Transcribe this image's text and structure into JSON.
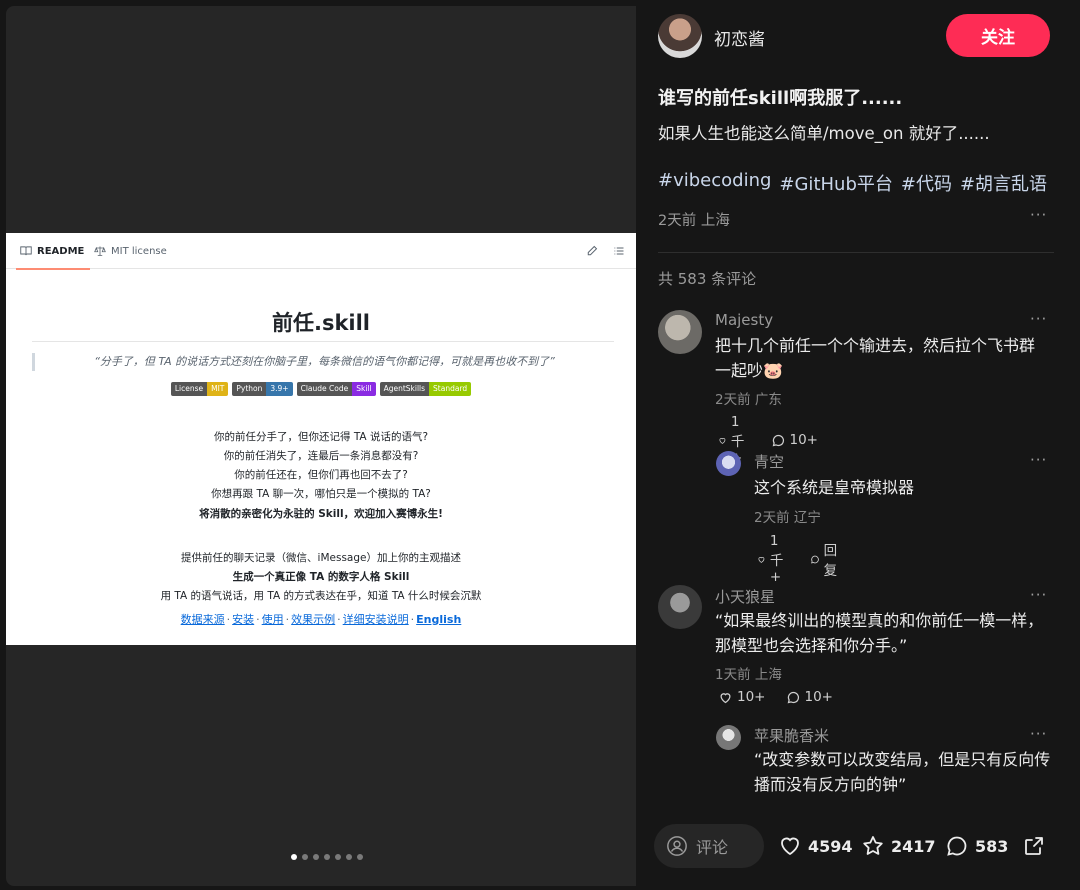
{
  "readme": {
    "tab_readme": "README",
    "tab_license": "MIT license",
    "title": "前任.skill",
    "quote": "“分手了，但 TA 的说话方式还刻在你脑子里，每条微信的语气你都记得，可就是再也收不到了”",
    "badges": [
      {
        "label": "License",
        "value": "MIT",
        "color": "#dfb317"
      },
      {
        "label": "Python",
        "value": "3.9+",
        "color": "#3776ab"
      },
      {
        "label": "Claude Code",
        "value": "Skill",
        "color": "#8a2be2"
      },
      {
        "label": "AgentSkills",
        "value": "Standard",
        "color": "#97ca00"
      }
    ],
    "questions": [
      "你的前任分手了，但你还记得 TA 说话的语气?",
      "你的前任消失了，连最后一条消息都没有?",
      "你的前任还在，但你们再也回不去了?",
      "你想再跟 TA 聊一次，哪怕只是一个模拟的 TA?"
    ],
    "tagline": "将消散的亲密化为永驻的 Skill，欢迎加入赛博永生!",
    "desc": [
      "提供前任的聊天记录（微信、iMessage）加上你的主观描述",
      "生成一个真正像 TA 的数字人格 Skill",
      "用 TA 的语气说话，用 TA 的方式表达在乎，知道 TA 什么时候会沉默"
    ],
    "links": [
      "数据来源",
      "安装",
      "使用",
      "效果示例",
      "详细安装说明",
      "English"
    ],
    "link_sep": "·"
  },
  "carousel": {
    "count": 7,
    "active": 0
  },
  "author": {
    "name": "初恋酱",
    "follow_label": "关注"
  },
  "post": {
    "title": "谁写的前任skill啊我服了......",
    "body": "如果人生也能这么简单/move_on 就好了......",
    "tags": [
      "#vibecoding",
      "#GitHub平台",
      "#代码",
      "#胡言乱语"
    ],
    "meta": "2天前 上海",
    "more": "···"
  },
  "comments_header": "共 583 条评论",
  "comments": [
    {
      "name": "Majesty",
      "text": "把十几个前任一个个输进去，然后拉个飞书群一起吵",
      "emoji": "🐷",
      "meta": "2天前 广东",
      "likes": "1千+",
      "replies": "10+",
      "more": "···"
    },
    {
      "name": "青空",
      "text": "这个系统是皇帝模拟器",
      "meta": "2天前 辽宁",
      "likes": "1千+",
      "replies": "回复",
      "more": "···"
    },
    {
      "name": "小天狼星",
      "text": "“如果最终训出的模型真的和你前任一模一样，那模型也会选择和你分手。”",
      "meta": "1天前 上海",
      "likes": "10+",
      "replies": "10+",
      "more": "···"
    },
    {
      "name": "苹果脆香米",
      "text": "“改变参数可以改变结局，但是只有反向传播而没有反方向的钟”",
      "meta": "",
      "more": "···"
    }
  ],
  "bottom": {
    "comment_placeholder": "评论",
    "likes": "4594",
    "favorites": "2417",
    "comments": "583"
  }
}
